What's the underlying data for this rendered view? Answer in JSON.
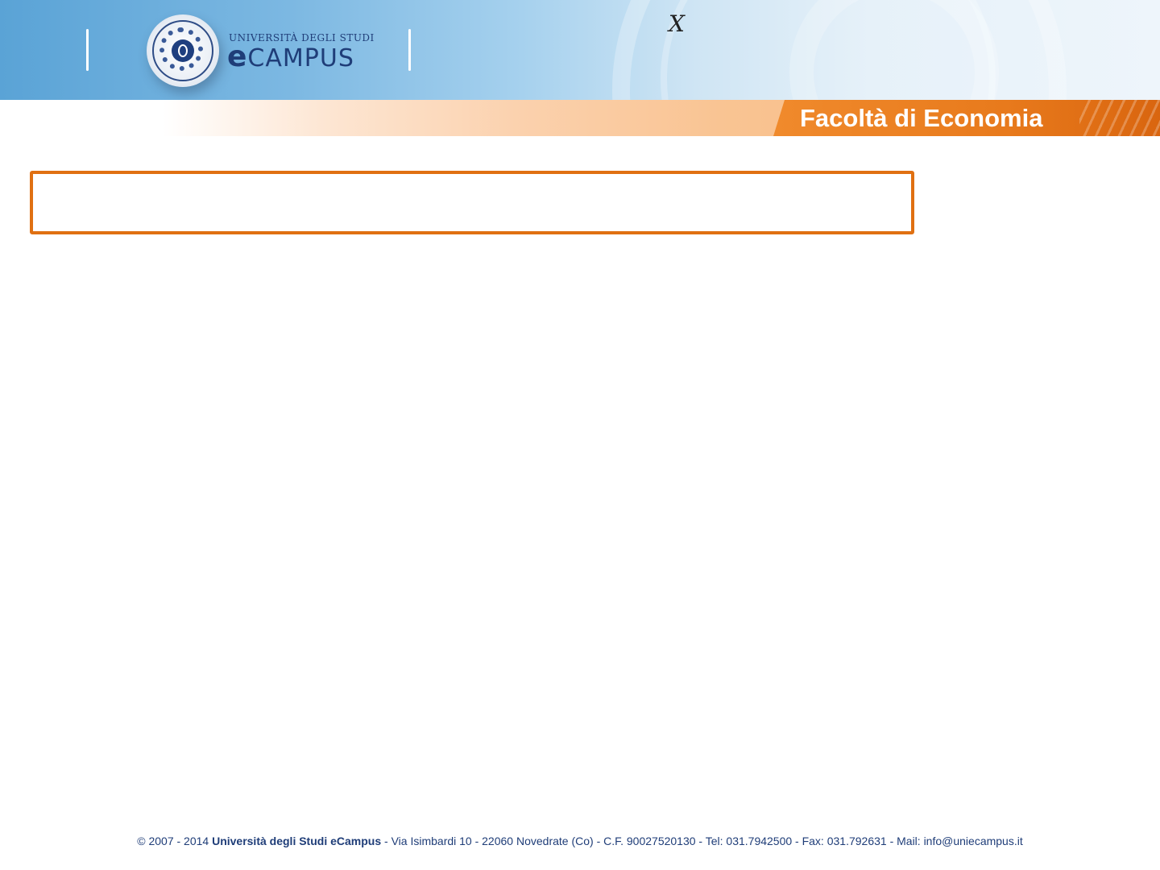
{
  "header": {
    "logo": {
      "university_line": "UNIVERSITÀ DEGLI STUDI",
      "name_e": "e",
      "name_rest": "CAMPUS"
    },
    "stray_glyph": "X",
    "faculty_title": "Facoltà di Economia"
  },
  "slide": {
    "title_box_text": ""
  },
  "footer": {
    "copyright": "© 2007 - 2014",
    "university": "Università degli Studi eCampus",
    "details": "- Via Isimbardi 10 - 22060 Novedrate (Co) - C.F. 90027520130 - Tel: 031.7942500 - Fax: 031.792631   - Mail: info@uniecampus.it"
  },
  "colors": {
    "accent_orange": "#e07012",
    "brand_blue": "#1f3d78",
    "header_blue": "#5aa3d6"
  }
}
